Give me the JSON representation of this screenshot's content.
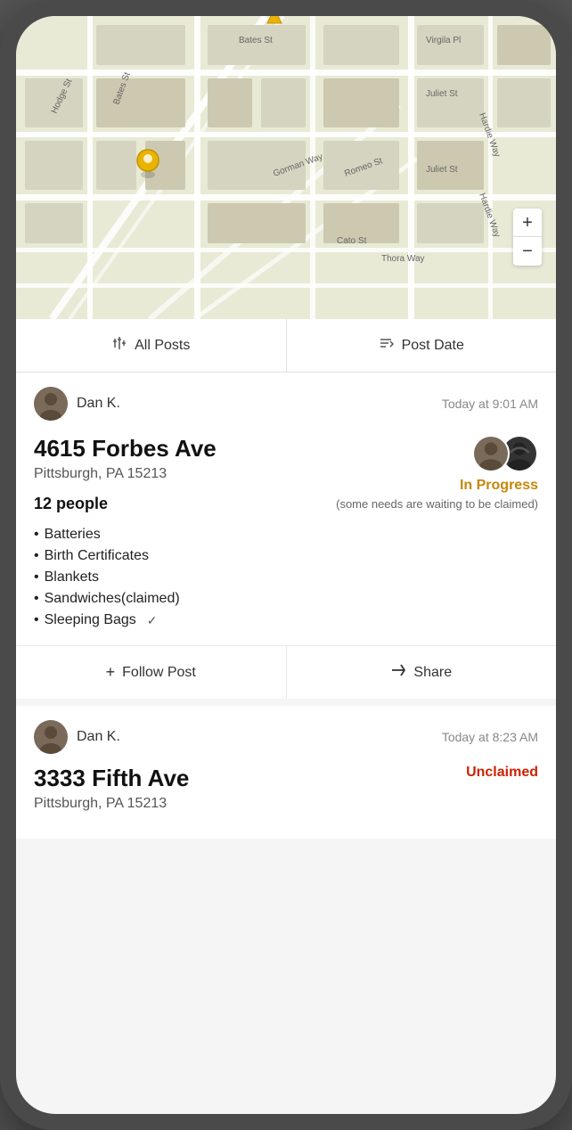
{
  "map": {
    "zoom_in": "+",
    "zoom_out": "−"
  },
  "filter_bar": {
    "all_posts_label": "All Posts",
    "post_date_label": "Post Date"
  },
  "post1": {
    "author": "Dan K.",
    "time": "Today at 9:01 AM",
    "address_main": "4615 Forbes Ave",
    "address_sub": "Pittsburgh, PA 15213",
    "people": "12 people",
    "needs": [
      "Batteries",
      "Birth Certificates",
      "Blankets",
      "Sandwiches(claimed)",
      "Sleeping Bags"
    ],
    "status": "In Progress",
    "status_note": "(some needs are waiting to be claimed)",
    "follow_label": "Follow Post",
    "share_label": "Share"
  },
  "post2": {
    "author": "Dan K.",
    "time": "Today at 8:23 AM",
    "address_main": "3333 Fifth Ave",
    "address_sub": "Pittsburgh, PA 15213",
    "status": "Unclaimed"
  }
}
